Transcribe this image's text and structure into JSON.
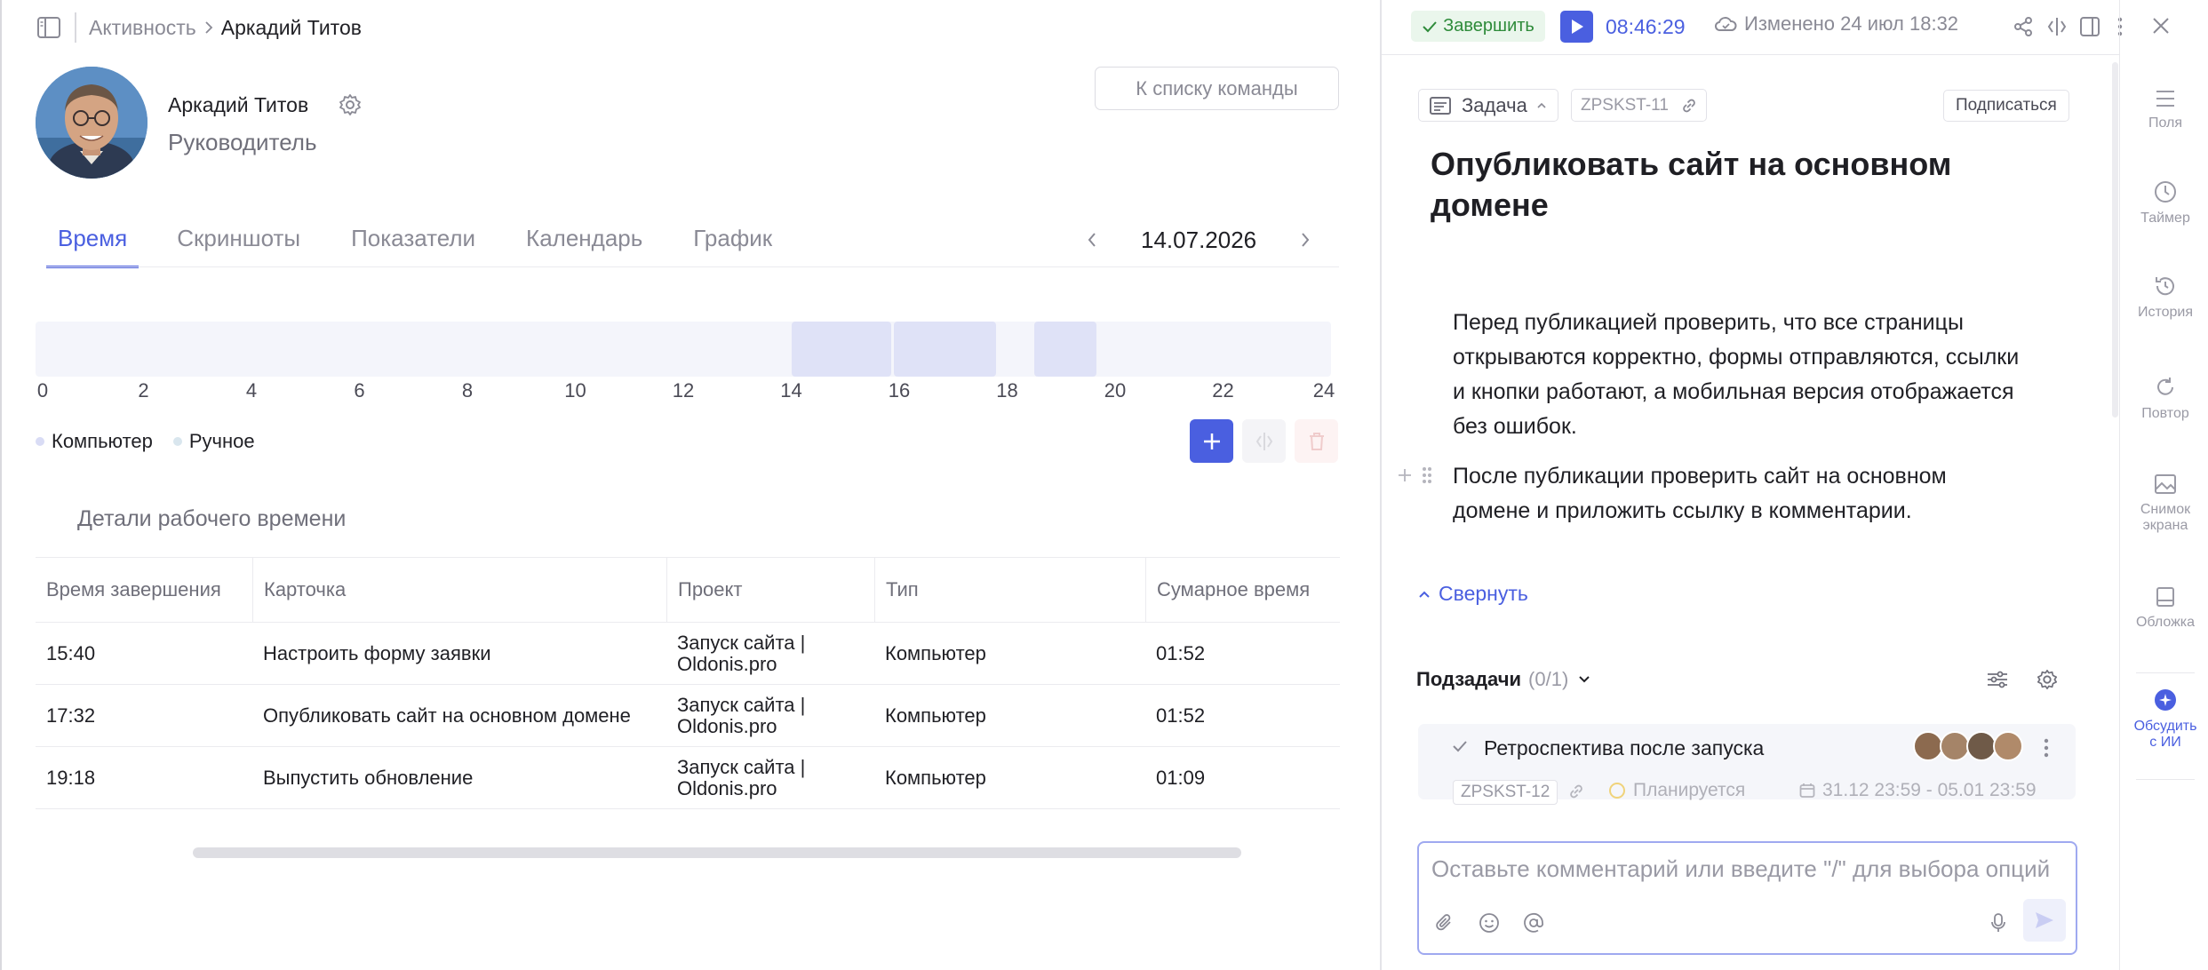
{
  "breadcrumb": {
    "parent": "Активность",
    "current": "Аркадий Титов"
  },
  "profile": {
    "name": "Аркадий Титов",
    "role": "Руководитель",
    "team_button": "К списку команды"
  },
  "tabs": [
    "Время",
    "Скриншоты",
    "Показатели",
    "Календарь",
    "График"
  ],
  "active_tab": "Время",
  "date": "14.07.2026",
  "timeline": {
    "ticks": [
      "0",
      "2",
      "4",
      "6",
      "8",
      "10",
      "12",
      "14",
      "16",
      "18",
      "20",
      "22",
      "24"
    ],
    "range_hours": [
      0,
      24
    ],
    "segments": [
      {
        "start": 14.0,
        "end": 15.9
      },
      {
        "start": 15.9,
        "end": 17.85
      },
      {
        "start": 18.5,
        "end": 19.7
      }
    ],
    "legend": [
      "Компьютер",
      "Ручное"
    ],
    "colors": {
      "computer": "#d9dcf5",
      "manual": "#d9e6ee",
      "accent": "#4a5fe0"
    }
  },
  "details_title": "Детали рабочего времени",
  "table": {
    "headers": [
      "Время завершения",
      "Карточка",
      "Проект",
      "Тип",
      "Сумарное время"
    ],
    "rows": [
      {
        "end": "15:40",
        "card": "Настроить форму заявки",
        "project1": "Запуск сайта |",
        "project2": "Oldonis.pro",
        "type": "Компьютер",
        "total": "01:52"
      },
      {
        "end": "17:32",
        "card": "Опубликовать сайт на основном домене",
        "project1": "Запуск сайта |",
        "project2": "Oldonis.pro",
        "type": "Компьютер",
        "total": "01:52"
      },
      {
        "end": "19:18",
        "card": "Выпустить обновление",
        "project1": "Запуск сайта |",
        "project2": "Oldonis.pro",
        "type": "Компьютер",
        "total": "01:09"
      }
    ]
  },
  "task_panel": {
    "finish_label": "Завершить",
    "timer": "08:46:29",
    "changed": "Изменено 24 июл 18:32",
    "type_label": "Задача",
    "code": "ZPSKST-11",
    "subscribe": "Подписаться",
    "title": "Опубликовать сайт на основном домене",
    "paragraph1": "Перед публикацией проверить, что все страницы открываются корректно, формы отправляются, ссылки и кнопки работают, а мобильная версия отображается без ошибок.",
    "paragraph2": "После публикации проверить сайт на основном домене и приложить ссылку в комментарии.",
    "collapse": "Свернуть",
    "subtasks_label": "Подзадачи",
    "subtasks_count": "(0/1)",
    "subtask": {
      "name": "Ретроспектива после запуска",
      "code": "ZPSKST-12",
      "status": "Планируется",
      "dates": "31.12 23:59 - 05.01 23:59"
    },
    "comment_placeholder": "Оставьте комментарий или введите \"/\" для выбора опций"
  },
  "side_panel": [
    {
      "label": "Поля",
      "icon": "list-icon"
    },
    {
      "label": "Таймер",
      "icon": "clock-icon"
    },
    {
      "label": "История",
      "icon": "history-icon"
    },
    {
      "label": "Повтор",
      "icon": "repeat-icon"
    },
    {
      "label": "Снимок экрана",
      "icon": "image-icon"
    },
    {
      "label": "Обложка",
      "icon": "cover-icon"
    },
    {
      "label": "Обсудить с ИИ",
      "icon": "ai-icon"
    }
  ]
}
